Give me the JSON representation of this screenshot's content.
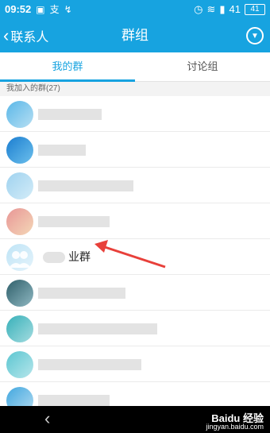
{
  "status_bar": {
    "time": "09:52",
    "icons_left": [
      "image-icon",
      "sogou-icon",
      "usb-icon"
    ],
    "icons_right": [
      "alarm-icon",
      "wifi-icon",
      "signal-icon"
    ],
    "signal": "41",
    "battery": "41"
  },
  "nav": {
    "back_label": "联系人",
    "title": "群组",
    "menu_icon": "chevron-down-circle-icon",
    "color": "#17a3e0"
  },
  "tabs": [
    {
      "label": "我的群",
      "active": true
    },
    {
      "label": "讨论组",
      "active": false
    }
  ],
  "section": {
    "header": "我加入的群(27)"
  },
  "groups": [
    {
      "name": "",
      "blurred": true,
      "avatar_colors": [
        "#5ab7e8",
        "#b7dff3"
      ]
    },
    {
      "name": "",
      "blurred": true,
      "avatar_colors": [
        "#1b7dd0",
        "#6cc0ec"
      ]
    },
    {
      "name": "",
      "blurred": true,
      "avatar_colors": [
        "#9fd2ef",
        "#d3ecf8"
      ]
    },
    {
      "name": "",
      "blurred": true,
      "avatar_colors": [
        "#e89696",
        "#f4d7b7"
      ]
    },
    {
      "name": "业群",
      "blurred": false,
      "avatar_colors": [
        "#bfe4f6",
        "#e4f3fb"
      ]
    },
    {
      "name": "",
      "blurred": true,
      "avatar_colors": [
        "#2f5f6a",
        "#8fb8c2"
      ]
    },
    {
      "name": "",
      "blurred": true,
      "avatar_colors": [
        "#37b0b9",
        "#a4dce0"
      ]
    },
    {
      "name": "",
      "blurred": true,
      "avatar_colors": [
        "#5cc6d1",
        "#b6e6eb"
      ]
    },
    {
      "name": "",
      "blurred": true,
      "avatar_colors": [
        "#42a7df",
        "#b2dbf1"
      ]
    }
  ],
  "annotation": {
    "arrow_color": "#e8403a"
  },
  "bottom_bar": {
    "back_icon": "back-chevron-icon"
  },
  "watermark": {
    "line1": "Baidu 经验",
    "line2": "jingyan.baidu.com"
  }
}
